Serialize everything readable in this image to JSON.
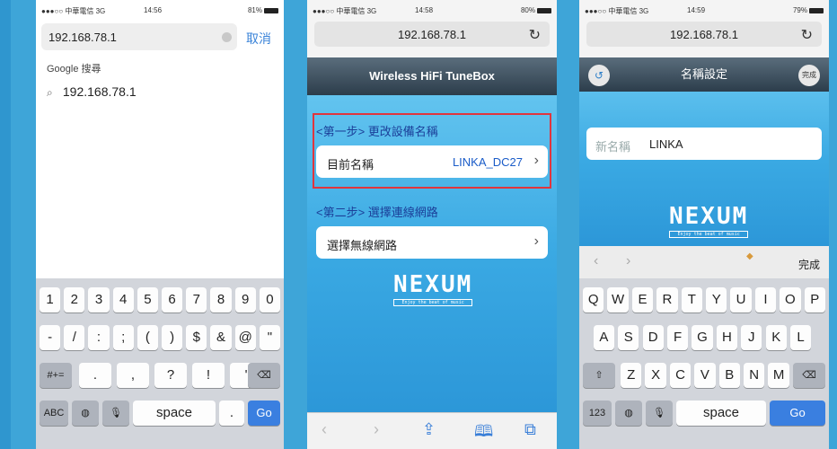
{
  "phone1": {
    "status": {
      "carrier": "●●●○○ 中華電信 3G",
      "time": "14:56",
      "battery": "81%"
    },
    "url_value": "192.168.78.1",
    "cancel_label": "取消",
    "google_search_label": "Google 搜尋",
    "suggestion": "192.168.78.1",
    "keyboard": {
      "row1": [
        "1",
        "2",
        "3",
        "4",
        "5",
        "6",
        "7",
        "8",
        "9",
        "0"
      ],
      "row2": [
        "-",
        "/",
        ":",
        ";",
        "(",
        ")",
        "$",
        "&",
        "@",
        "\""
      ],
      "row3_mode": "#+=",
      "row3": [
        ".",
        ",",
        "?",
        "!",
        "'"
      ],
      "abc": "ABC",
      "space": "space",
      "dot": ".",
      "go": "Go"
    }
  },
  "phone2": {
    "status": {
      "carrier": "●●●○○ 中華電信 3G",
      "time": "14:58",
      "battery": "80%"
    },
    "url": "192.168.78.1",
    "app_title": "Wireless HiFi TuneBox",
    "step1_label": "<第一步> 更改設備名稱",
    "current_name_label": "目前名稱",
    "current_name_value": "LINKA_DC27",
    "step2_label": "<第二步> 選擇連線網路",
    "select_network_label": "選擇無線網路",
    "logo_text": "NEXUM",
    "logo_sub": "Enjoy the beat of music"
  },
  "phone3": {
    "status": {
      "carrier": "●●●○○ 中華電信 3G",
      "time": "14:59",
      "battery": "79%"
    },
    "url": "192.168.78.1",
    "header_title": "名稱設定",
    "done_circle_label": "完成",
    "new_name_label": "新名稱",
    "new_name_value": "LINKA",
    "logo_text": "NEXUM",
    "logo_sub": "Enjoy the beat of music",
    "accessory_done": "完成",
    "keyboard": {
      "row1": [
        "Q",
        "W",
        "E",
        "R",
        "T",
        "Y",
        "U",
        "I",
        "O",
        "P"
      ],
      "row2": [
        "A",
        "S",
        "D",
        "F",
        "G",
        "H",
        "J",
        "K",
        "L"
      ],
      "row3": [
        "Z",
        "X",
        "C",
        "V",
        "B",
        "N",
        "M"
      ],
      "num": "123",
      "space": "space",
      "go": "Go"
    }
  },
  "colors": {
    "accent_blue": "#3a7fe0",
    "highlight_red": "#e0353d",
    "header_dark": "#2c3d4b",
    "page_blue": "#3ea5d8"
  }
}
